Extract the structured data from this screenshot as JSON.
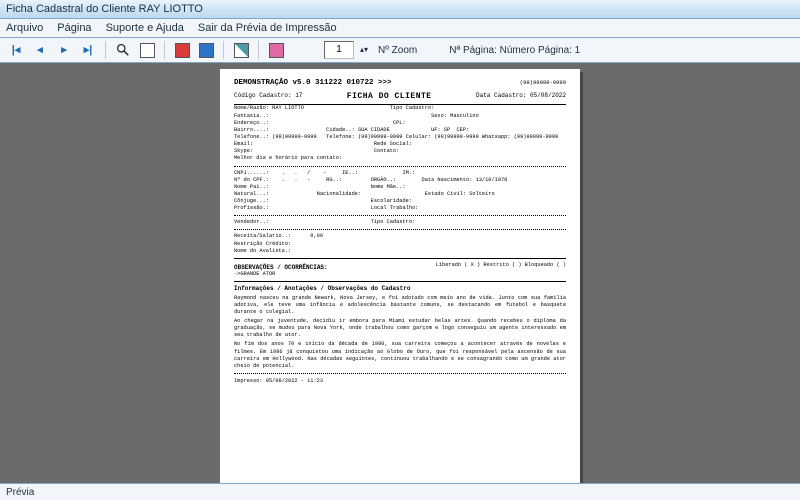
{
  "window": {
    "title": "Ficha Cadastral do Cliente RAY LIOTTO"
  },
  "menu": {
    "arquivo": "Arquivo",
    "pagina": "Página",
    "suporte": "Suporte e Ajuda",
    "sair": "Sair da Prévia de Impressão"
  },
  "toolbar": {
    "zoom_value": "1",
    "zoom_arrows": "▴▾",
    "zoom_label": "Nº Zoom",
    "pagina_label": "Nª Página: Número Página: 1"
  },
  "page": {
    "header_title": "DEMONSTRAÇÃO v5.0 311222 010722 >>>",
    "header_tel": "(99)99999-9999",
    "sub_left": "Código Cadastro:    17",
    "sub_mid": "FICHA DO CLIENTE",
    "sub_right": "Data Cadastro: 05/08/2022",
    "block1": "Nome/Razão: RAY LIOTTO                           Tipo Cadastro:\nFantasia..:                                                   Sexo: Masculino\nEndereço..:                                       CPL:\nBairro....:                  Cidade..: SUA CIDADE             UF: SP  CEP:\nTelefone..: (99)99999-9999   Telefone: (99)99999-9999 Celular: (99)99999-9999 Whatsapp: (99)99999-9999\nEmail:                                      Rede Social:\nSkype:                                      Contato:\nMelhor dia e horário para contato:",
    "block2": "CNPJ......:    .   .   /    -     IE..:              IM.:\nNº do CPF.:    .   .   -     RG..:         ORGÃO..:        Data Nascimento: 13/10/1978\nNome Pai..:                                Nome Mãe..:\nNatural...:               Nacionalidade:                    Estado Civil: Solteiro\nCônjuge...:                                Escolaridade:\nProfissão.:                                Local Trabalho:",
    "block3": "Vendedor..:                                Tipo Cadastro:",
    "block4": "Receita/Salario..:      0,00\nRestrição Crédito:\nNome do Avalista.:",
    "obs_title": "OBSERVAÇÕES / OCORRÊNCIAS:",
    "obs_right": "Liberado ( X )    Restrito (   )    Bloqueado (   )",
    "obs_tag": "->GRANDE ATOR",
    "info_title": "Informações / Anotações / Observações do Cadastro",
    "para1": "Raymond nasceu na grande Newark, Nova Jersey, e foi adotado com meio ano de vida. Junto com sua família adotiva, ele teve uma infância e adolescência bastante comuns, se destacando em futebol e basquete durante o colegial.",
    "para2": "Ao chegar na juventude, decidiu ir embora para Miami estudar belas artes. Quando recebeu o diploma da graduação, se mudou para Nova York, onde trabalhou como garçom e logo conseguiu um agente interessado em seu trabalho de ator.",
    "para3": "No fim dos anos 70 e início da década de 1980, sua carreira começou a acontecer através de novelas e filmes. Em 1986 já conquistou uma indicação ao Globo de Ouro, que foi responsável pela ascensão de sua carreira em Hollywood. Nas décadas seguintes, continuou trabalhando e se consagrando como um grande ator cheio de potencial.",
    "impresso": "Impresso: 05/08/2022 - 11:23"
  },
  "status": {
    "label": "Prévia"
  }
}
